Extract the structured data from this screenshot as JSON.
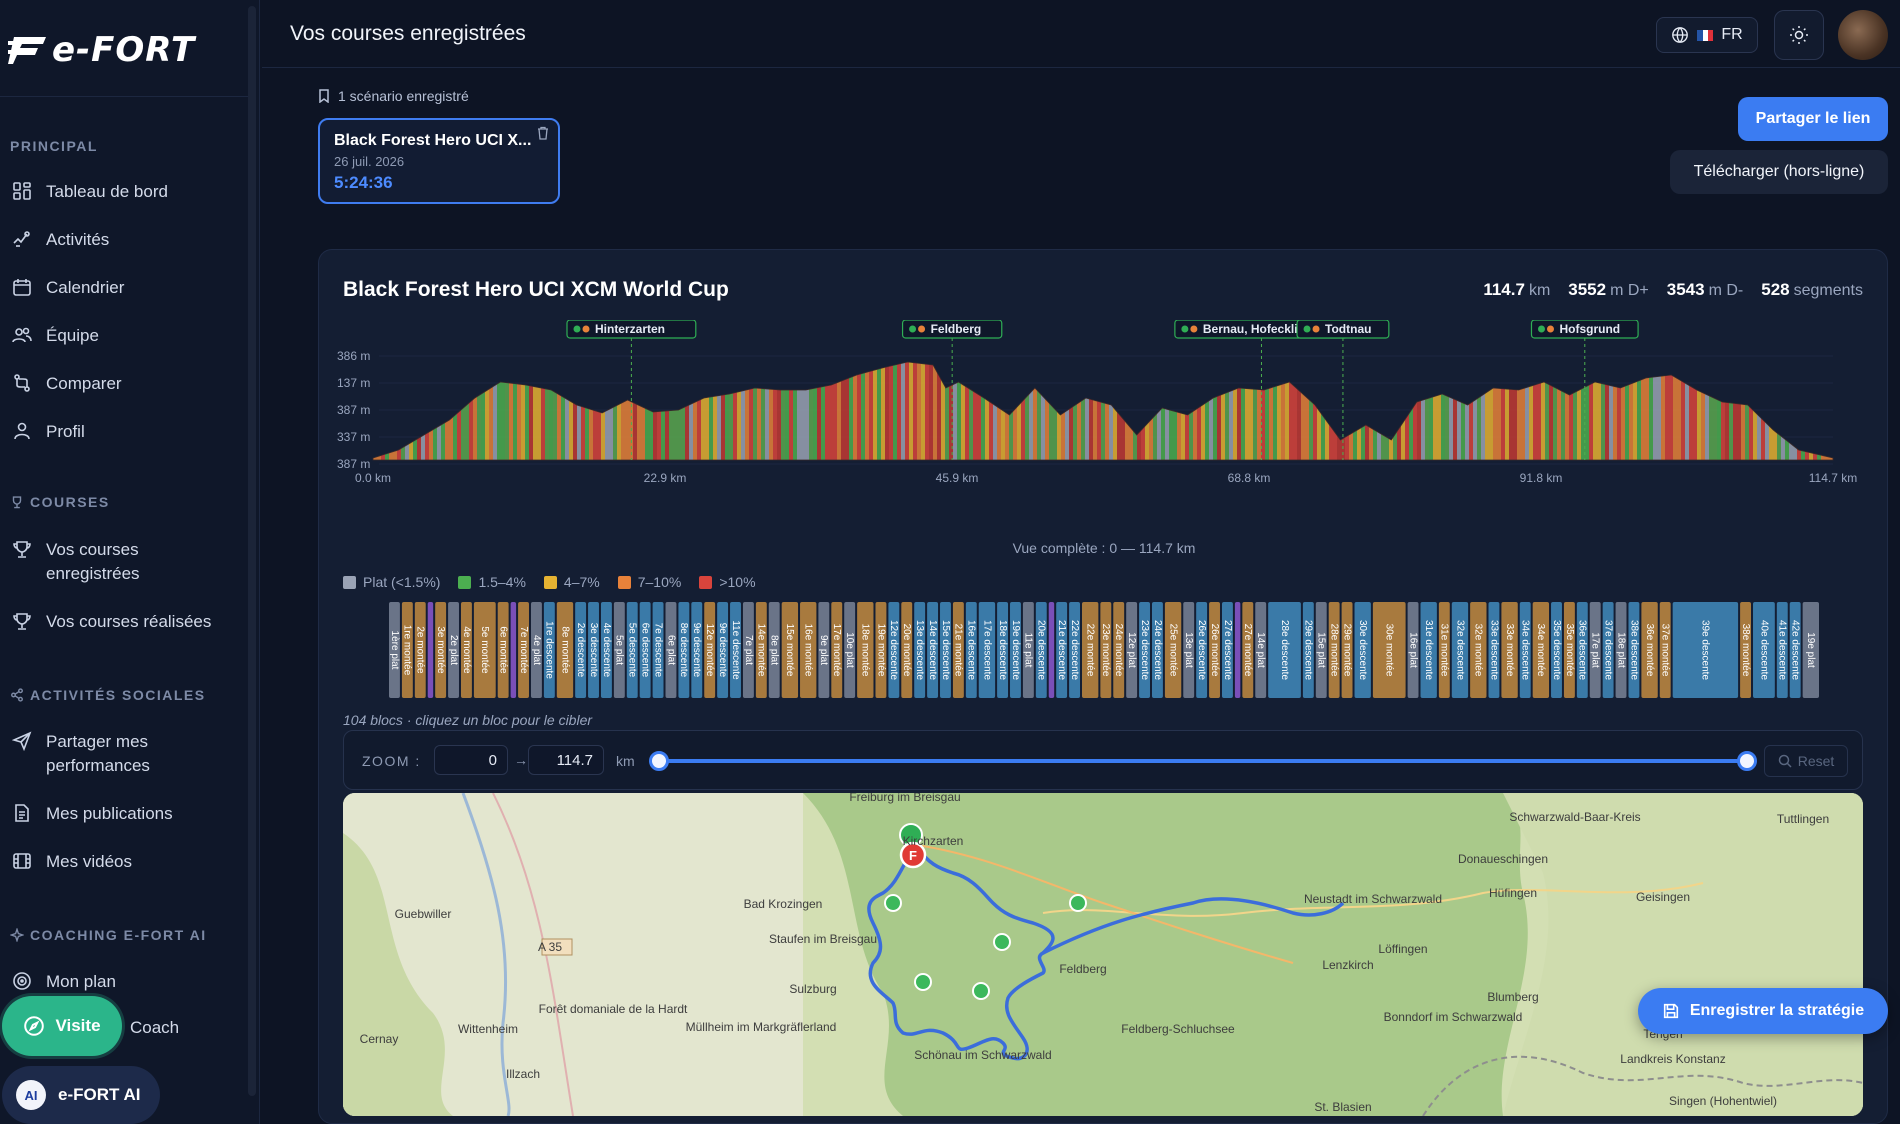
{
  "app": {
    "logo_text": "e-FORT",
    "page_title": "Vos courses enregistrées"
  },
  "header": {
    "language": "FR",
    "icons": [
      "globe-icon",
      "sun-icon"
    ]
  },
  "sidebar": {
    "sections": [
      {
        "label": "PRINCIPAL"
      },
      {
        "label": "COURSES"
      },
      {
        "label": "ACTIVITÉS SOCIALES"
      },
      {
        "label": "COACHING E-FORT AI"
      }
    ],
    "items": [
      {
        "label": "Tableau de bord",
        "icon": "dashboard-icon"
      },
      {
        "label": "Activités",
        "icon": "activity-icon"
      },
      {
        "label": "Calendrier",
        "icon": "calendar-icon"
      },
      {
        "label": "Équipe",
        "icon": "team-icon"
      },
      {
        "label": "Comparer",
        "icon": "compare-icon"
      },
      {
        "label": "Profil",
        "icon": "user-icon"
      },
      {
        "label": "Vos courses enregistrées",
        "icon": "trophy-icon"
      },
      {
        "label": "Vos courses réalisées",
        "icon": "trophy-icon"
      },
      {
        "label": "Partager mes performances",
        "icon": "send-icon"
      },
      {
        "label": "Mes publications",
        "icon": "document-icon"
      },
      {
        "label": "Mes vidéos",
        "icon": "video-icon"
      },
      {
        "label": "Mon plan",
        "icon": "target-icon"
      }
    ],
    "visite_label": "Visite",
    "coach_label": "Coach",
    "ai_label": "e-FORT AI"
  },
  "scenarios": {
    "count_label": "1 scénario enregistré",
    "card": {
      "title": "Black Forest Hero UCI X...",
      "date": "26 juil. 2026",
      "time": "5:24:36"
    }
  },
  "actions": {
    "share": "Partager le lien",
    "download": "Télécharger (hors-ligne)",
    "save": "Enregistrer la stratégie"
  },
  "course": {
    "title": "Black Forest Hero UCI XCM World Cup",
    "distance": "114.7",
    "distance_unit": "km",
    "gain": "3552",
    "gain_unit": "m D+",
    "loss": "3543",
    "loss_unit": "m D-",
    "segments": "528",
    "segments_unit": "segments",
    "view_label": "Vue complète : 0 — 114.7 km",
    "blocks_note": "104 blocs · cliquez un bloc pour le cibler"
  },
  "legend": [
    {
      "label": "Plat (<1.5%)",
      "color": "#9aa3b5"
    },
    {
      "label": "1.5–4%",
      "color": "#4caf50"
    },
    {
      "label": "4–7%",
      "color": "#e6b332"
    },
    {
      "label": "7–10%",
      "color": "#e8823a"
    },
    {
      "label": ">10%",
      "color": "#d9443c"
    }
  ],
  "zoom": {
    "label": "ZOOM :",
    "from": "0",
    "to": "114.7",
    "unit": "km",
    "reset": "Reset",
    "range_fraction": [
      0,
      1
    ]
  },
  "chart_data": {
    "type": "area",
    "xlabel": "",
    "ylabel": "",
    "x_ticks": [
      "0.0 km",
      "22.9 km",
      "45.9 km",
      "68.8 km",
      "91.8 km",
      "114.7 km"
    ],
    "y_ticks": [
      "386 m",
      "137 m",
      "387 m",
      "337 m",
      "387 m"
    ],
    "xlim": [
      0,
      114.7
    ],
    "x": [
      0,
      2,
      4,
      6,
      8,
      10,
      12,
      14,
      16,
      18,
      20,
      22,
      24,
      26,
      28,
      30,
      32,
      34,
      36,
      38,
      40,
      42,
      44,
      45,
      46,
      48,
      50,
      52,
      54,
      56,
      58,
      60,
      62,
      64,
      66,
      68,
      70,
      72,
      74,
      76,
      78,
      80,
      82,
      84,
      86,
      88,
      90,
      92,
      94,
      96,
      98,
      100,
      102,
      104,
      106,
      108,
      110,
      112,
      114.7
    ],
    "y": [
      0.02,
      0.1,
      0.25,
      0.4,
      0.62,
      0.78,
      0.75,
      0.7,
      0.55,
      0.47,
      0.6,
      0.48,
      0.5,
      0.62,
      0.66,
      0.72,
      0.7,
      0.7,
      0.75,
      0.85,
      0.92,
      0.98,
      0.95,
      0.72,
      0.78,
      0.62,
      0.45,
      0.72,
      0.45,
      0.62,
      0.55,
      0.25,
      0.52,
      0.45,
      0.62,
      0.72,
      0.7,
      0.78,
      0.55,
      0.2,
      0.35,
      0.2,
      0.58,
      0.66,
      0.55,
      0.72,
      0.7,
      0.78,
      0.65,
      0.78,
      0.72,
      0.82,
      0.85,
      0.7,
      0.58,
      0.55,
      0.3,
      0.1,
      0.02
    ],
    "annotations": [
      {
        "label": "Hinterzarten",
        "x": 20.3
      },
      {
        "label": "Feldberg",
        "x": 45.5
      },
      {
        "label": "Bernau, Hofecklift",
        "x": 69.8
      },
      {
        "label": "Todtnau",
        "x": 76.2
      },
      {
        "label": "Hofsgrund",
        "x": 95.2
      }
    ]
  },
  "blocks": [
    {
      "label": "1ère plat",
      "color": "#6a7488",
      "w": 1
    },
    {
      "label": "1re montée",
      "color": "#a87a3e",
      "w": 1
    },
    {
      "label": "2e montée",
      "color": "#a87a3e",
      "w": 1
    },
    {
      "label": "mur #1",
      "color": "#7a4fb8",
      "w": 0.5
    },
    {
      "label": "3e montée",
      "color": "#a87a3e",
      "w": 1
    },
    {
      "label": "2e plat",
      "color": "#6a7488",
      "w": 1
    },
    {
      "label": "4e montée",
      "color": "#a87a3e",
      "w": 1
    },
    {
      "label": "5e montée",
      "color": "#a87a3e",
      "w": 2
    },
    {
      "label": "6e montée",
      "color": "#a87a3e",
      "w": 1
    },
    {
      "label": "mur #2",
      "color": "#7a4fb8",
      "w": 0.5
    },
    {
      "label": "7e montée",
      "color": "#a87a3e",
      "w": 1
    },
    {
      "label": "4e plat",
      "color": "#6a7488",
      "w": 1
    },
    {
      "label": "1re descente",
      "color": "#3a7aa8",
      "w": 1
    },
    {
      "label": "8e montée",
      "color": "#a87a3e",
      "w": 1.5
    },
    {
      "label": "2e descente",
      "color": "#3a7aa8",
      "w": 1
    },
    {
      "label": "3e descente",
      "color": "#3a7aa8",
      "w": 1
    },
    {
      "label": "4e descente",
      "color": "#3a7aa8",
      "w": 1
    },
    {
      "label": "5e plat",
      "color": "#6a7488",
      "w": 1
    },
    {
      "label": "5e descente",
      "color": "#3a7aa8",
      "w": 1
    },
    {
      "label": "6e descente",
      "color": "#3a7aa8",
      "w": 1
    },
    {
      "label": "7e descente",
      "color": "#3a7aa8",
      "w": 1
    },
    {
      "label": "6e plat",
      "color": "#6a7488",
      "w": 1
    },
    {
      "label": "8e descente",
      "color": "#3a7aa8",
      "w": 1
    },
    {
      "label": "9e descente",
      "color": "#3a7aa8",
      "w": 1
    },
    {
      "label": "12e montée",
      "color": "#a87a3e",
      "w": 1
    },
    {
      "label": "9e descente",
      "color": "#3a7aa8",
      "w": 1
    },
    {
      "label": "11e descente",
      "color": "#3a7aa8",
      "w": 1
    },
    {
      "label": "7e plat",
      "color": "#6a7488",
      "w": 1
    },
    {
      "label": "14e montée",
      "color": "#a87a3e",
      "w": 1
    },
    {
      "label": "8e plat",
      "color": "#6a7488",
      "w": 1
    },
    {
      "label": "15e montée",
      "color": "#a87a3e",
      "w": 1.5
    },
    {
      "label": "16e montée",
      "color": "#a87a3e",
      "w": 1.5
    },
    {
      "label": "9e plat",
      "color": "#6a7488",
      "w": 1
    },
    {
      "label": "17e montée",
      "color": "#a87a3e",
      "w": 1
    },
    {
      "label": "10e plat",
      "color": "#6a7488",
      "w": 1
    },
    {
      "label": "18e montée",
      "color": "#a87a3e",
      "w": 1.5
    },
    {
      "label": "19e montée",
      "color": "#a87a3e",
      "w": 1
    },
    {
      "label": "12e descente",
      "color": "#3a7aa8",
      "w": 1
    },
    {
      "label": "20e montée",
      "color": "#a87a3e",
      "w": 1
    },
    {
      "label": "13e descente",
      "color": "#3a7aa8",
      "w": 1
    },
    {
      "label": "14e descente",
      "color": "#3a7aa8",
      "w": 1
    },
    {
      "label": "15e descente",
      "color": "#3a7aa8",
      "w": 1
    },
    {
      "label": "21e montée",
      "color": "#a87a3e",
      "w": 1
    },
    {
      "label": "16e descente",
      "color": "#3a7aa8",
      "w": 1
    },
    {
      "label": "17e descente",
      "color": "#3a7aa8",
      "w": 1.5
    },
    {
      "label": "18e descente",
      "color": "#3a7aa8",
      "w": 1
    },
    {
      "label": "19e descente",
      "color": "#3a7aa8",
      "w": 1
    },
    {
      "label": "11e plat",
      "color": "#6a7488",
      "w": 1
    },
    {
      "label": "20e descente",
      "color": "#3a7aa8",
      "w": 1
    },
    {
      "label": "mur #3",
      "color": "#7a4fb8",
      "w": 0.5
    },
    {
      "label": "21e descente",
      "color": "#3a7aa8",
      "w": 1
    },
    {
      "label": "22e descente",
      "color": "#3a7aa8",
      "w": 1
    },
    {
      "label": "22e montée",
      "color": "#a87a3e",
      "w": 1.5
    },
    {
      "label": "23e montée",
      "color": "#a87a3e",
      "w": 1
    },
    {
      "label": "24e montée",
      "color": "#a87a3e",
      "w": 1
    },
    {
      "label": "12e plat",
      "color": "#6a7488",
      "w": 1
    },
    {
      "label": "23e descente",
      "color": "#3a7aa8",
      "w": 1
    },
    {
      "label": "24e descente",
      "color": "#3a7aa8",
      "w": 1
    },
    {
      "label": "25e montée",
      "color": "#a87a3e",
      "w": 1.5
    },
    {
      "label": "13e plat",
      "color": "#6a7488",
      "w": 1
    },
    {
      "label": "26e descente",
      "color": "#3a7aa8",
      "w": 1
    },
    {
      "label": "26e montée",
      "color": "#a87a3e",
      "w": 1
    },
    {
      "label": "27e descente",
      "color": "#3a7aa8",
      "w": 1
    },
    {
      "label": "mur #4",
      "color": "#7a4fb8",
      "w": 0.5
    },
    {
      "label": "27e montée",
      "color": "#a87a3e",
      "w": 1
    },
    {
      "label": "14e plat",
      "color": "#6a7488",
      "w": 1
    },
    {
      "label": "28e descente",
      "color": "#3a7aa8",
      "w": 3
    },
    {
      "label": "29e descente",
      "color": "#3a7aa8",
      "w": 1
    },
    {
      "label": "15e plat",
      "color": "#6a7488",
      "w": 1
    },
    {
      "label": "28e montée",
      "color": "#a87a3e",
      "w": 1
    },
    {
      "label": "29e montée",
      "color": "#a87a3e",
      "w": 1
    },
    {
      "label": "30e descente",
      "color": "#3a7aa8",
      "w": 1.5
    },
    {
      "label": "30e montée",
      "color": "#a87a3e",
      "w": 3
    },
    {
      "label": "16e plat",
      "color": "#6a7488",
      "w": 1
    },
    {
      "label": "31e descente",
      "color": "#3a7aa8",
      "w": 1.5
    },
    {
      "label": "31e montée",
      "color": "#a87a3e",
      "w": 1
    },
    {
      "label": "32e descente",
      "color": "#3a7aa8",
      "w": 1.5
    },
    {
      "label": "32e montée",
      "color": "#a87a3e",
      "w": 1.5
    },
    {
      "label": "33e descente",
      "color": "#3a7aa8",
      "w": 1
    },
    {
      "label": "33e montée",
      "color": "#a87a3e",
      "w": 1.5
    },
    {
      "label": "34e descente",
      "color": "#3a7aa8",
      "w": 1
    },
    {
      "label": "34e montée",
      "color": "#a87a3e",
      "w": 1.5
    },
    {
      "label": "35e descente",
      "color": "#3a7aa8",
      "w": 1
    },
    {
      "label": "35e montée",
      "color": "#a87a3e",
      "w": 1
    },
    {
      "label": "36e descente",
      "color": "#3a7aa8",
      "w": 1
    },
    {
      "label": "17e plat",
      "color": "#6a7488",
      "w": 1
    },
    {
      "label": "37e descente",
      "color": "#3a7aa8",
      "w": 1
    },
    {
      "label": "18e plat",
      "color": "#6a7488",
      "w": 1
    },
    {
      "label": "38e descente",
      "color": "#3a7aa8",
      "w": 1
    },
    {
      "label": "36e montée",
      "color": "#a87a3e",
      "w": 1.5
    },
    {
      "label": "37e montée",
      "color": "#a87a3e",
      "w": 1
    },
    {
      "label": "39e descente",
      "color": "#3a7aa8",
      "w": 6
    },
    {
      "label": "38e montée",
      "color": "#a87a3e",
      "w": 1
    },
    {
      "label": "40e descente",
      "color": "#3a7aa8",
      "w": 2
    },
    {
      "label": "41e descente",
      "color": "#3a7aa8",
      "w": 1
    },
    {
      "label": "42e descente",
      "color": "#3a7aa8",
      "w": 1
    },
    {
      "label": "19e plat",
      "color": "#6a7488",
      "w": 1.5
    }
  ],
  "map": {
    "places": [
      {
        "name": "Freiburg im Breisgau"
      },
      {
        "name": "Kirchzarten"
      },
      {
        "name": "Bad Krozingen"
      },
      {
        "name": "Staufen im Breisgau"
      },
      {
        "name": "Guebwiller"
      },
      {
        "name": "Sulzburg"
      },
      {
        "name": "Müllheim im Markgräflerland"
      },
      {
        "name": "Wittenheim"
      },
      {
        "name": "Cernay"
      },
      {
        "name": "Illzach"
      },
      {
        "name": "Forêt domaniale de la Hardt"
      },
      {
        "name": "A 35"
      },
      {
        "name": "Neustadt im Schwarzwald"
      },
      {
        "name": "Lenzkirch"
      },
      {
        "name": "Löffingen"
      },
      {
        "name": "Donaueschingen"
      },
      {
        "name": "Hüfingen"
      },
      {
        "name": "Geisingen"
      },
      {
        "name": "Tuttlingen"
      },
      {
        "name": "Schwarzwald-Baar-Kreis"
      },
      {
        "name": "Blumberg"
      },
      {
        "name": "Bonndorf im Schwarzwald"
      },
      {
        "name": "Tengen"
      },
      {
        "name": "Schönau im Schwarzwald"
      },
      {
        "name": "St. Blasien"
      },
      {
        "name": "Feldberg"
      },
      {
        "name": "Feldberg-Schluchsee"
      },
      {
        "name": "Landkreis Konstanz"
      },
      {
        "name": "Singen (Hohentwiel)"
      }
    ],
    "finish_marker": "F"
  }
}
